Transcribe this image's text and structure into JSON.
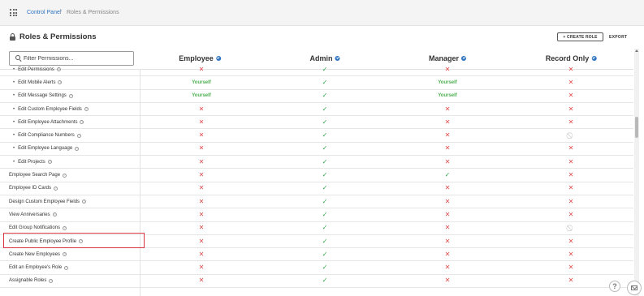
{
  "breadcrumb": {
    "link": "Control Panel",
    "separator": "/",
    "current": "Roles & Permissions"
  },
  "page": {
    "title": "Roles & Permissions",
    "create_role_label": "+ CREATE ROLE",
    "export_label": "EXPORT"
  },
  "search": {
    "placeholder": "Filter Permissions...",
    "value": ""
  },
  "columns": [
    "Employee",
    "Admin",
    "Manager",
    "Record Only"
  ],
  "icons": {
    "yes": "✓",
    "no": "✕",
    "na": "⃠"
  },
  "colors": {
    "accent": "#2f74c0",
    "yes": "#2fa84f",
    "no": "#e04848",
    "yourself": "#4caf50",
    "highlight": "#d9373f"
  },
  "rows": [
    {
      "label": "Edit Permissions",
      "sub": true,
      "values": [
        "no",
        "yes",
        "no",
        "no"
      ]
    },
    {
      "label": "Edit Mobile Alerts",
      "sub": true,
      "values": [
        "Yourself",
        "yes",
        "Yourself",
        "no"
      ]
    },
    {
      "label": "Edit Message Settings",
      "sub": true,
      "values": [
        "Yourself",
        "yes",
        "Yourself",
        "no"
      ]
    },
    {
      "label": "Edit Custom Employee Fields",
      "sub": true,
      "values": [
        "no",
        "yes",
        "no",
        "no"
      ]
    },
    {
      "label": "Edit Employee Attachments",
      "sub": true,
      "values": [
        "no",
        "yes",
        "no",
        "no"
      ]
    },
    {
      "label": "Edit Compliance Numbers",
      "sub": true,
      "values": [
        "no",
        "yes",
        "no",
        "na"
      ]
    },
    {
      "label": "Edit Employee Language",
      "sub": true,
      "values": [
        "no",
        "yes",
        "no",
        "no"
      ]
    },
    {
      "label": "Edit Projects",
      "sub": true,
      "values": [
        "no",
        "yes",
        "no",
        "no"
      ]
    },
    {
      "label": "Employee Search Page",
      "sub": false,
      "values": [
        "no",
        "yes",
        "yes",
        "no"
      ]
    },
    {
      "label": "Employee ID Cards",
      "sub": false,
      "values": [
        "no",
        "yes",
        "no",
        "no"
      ]
    },
    {
      "label": "Design Custom Employee Fields",
      "sub": false,
      "values": [
        "no",
        "yes",
        "no",
        "no"
      ]
    },
    {
      "label": "View Anniversaries",
      "sub": false,
      "values": [
        "no",
        "yes",
        "no",
        "no"
      ]
    },
    {
      "label": "Edit Group Notifications",
      "sub": false,
      "values": [
        "no",
        "yes",
        "no",
        "na"
      ]
    },
    {
      "label": "Create Public Employee Profile",
      "sub": false,
      "values": [
        "no",
        "yes",
        "no",
        "no"
      ]
    },
    {
      "label": "Create New Employees",
      "sub": false,
      "values": [
        "no",
        "yes",
        "no",
        "no"
      ]
    },
    {
      "label": "Edit an Employee's Role",
      "sub": false,
      "values": [
        "no",
        "yes",
        "no",
        "no"
      ]
    },
    {
      "label": "Assignable Roles",
      "sub": false,
      "values": [
        "no",
        "yes",
        "no",
        "no"
      ]
    }
  ],
  "fab": {
    "help": "?"
  }
}
